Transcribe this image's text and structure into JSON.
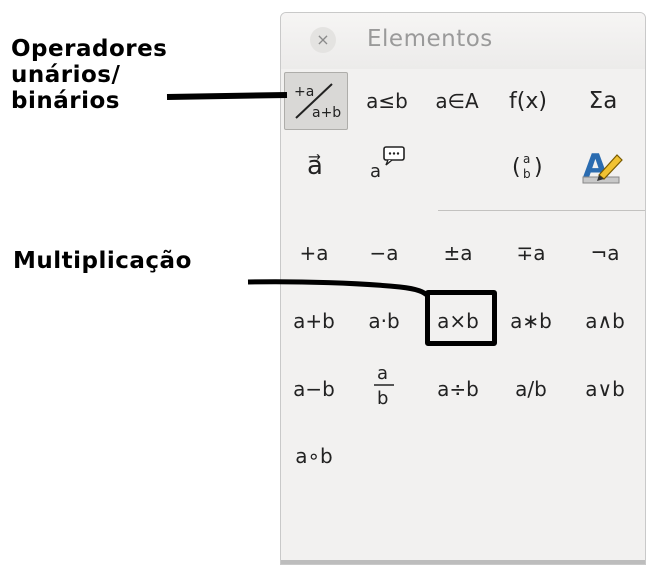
{
  "annotations": {
    "operators_lines": [
      "Operadores",
      "unários/",
      "binários"
    ],
    "multiplication": "Multiplicação"
  },
  "panel": {
    "title": "Elementos",
    "close_symbol": "×",
    "categories": [
      {
        "label": "+a/a+b",
        "icon": "unary-binary-operators-icon",
        "selected": true
      },
      {
        "label": "a≤b",
        "icon": "relations-icon"
      },
      {
        "label": "a∈A",
        "icon": "set-operations-icon"
      },
      {
        "label": "f(x)",
        "icon": "functions-icon"
      },
      {
        "label": "Σa",
        "icon": "operators-icon"
      },
      {
        "label": "a⃗",
        "icon": "attributes-icon"
      },
      {
        "label": "a",
        "icon": "others-icon"
      },
      {
        "label": "(a b)",
        "icon": "brackets-icon"
      },
      {
        "label": "A",
        "icon": "formats-icon"
      }
    ],
    "elements_rows": [
      [
        "+a",
        "−a",
        "±a",
        "∓a",
        "¬a"
      ],
      [
        "a+b",
        "a·b",
        "a×b",
        "a∗b",
        "a∧b"
      ],
      [
        "a−b",
        "a/b",
        "a÷b",
        "a/b",
        "a∨b"
      ],
      [
        "a∘b"
      ]
    ],
    "highlighted": "a×b"
  },
  "colors": {
    "panel_bg": "#f2f1f0",
    "callout_line": "#000000",
    "icon_yellow": "#f1c232",
    "icon_blue": "#2b6cb0"
  }
}
